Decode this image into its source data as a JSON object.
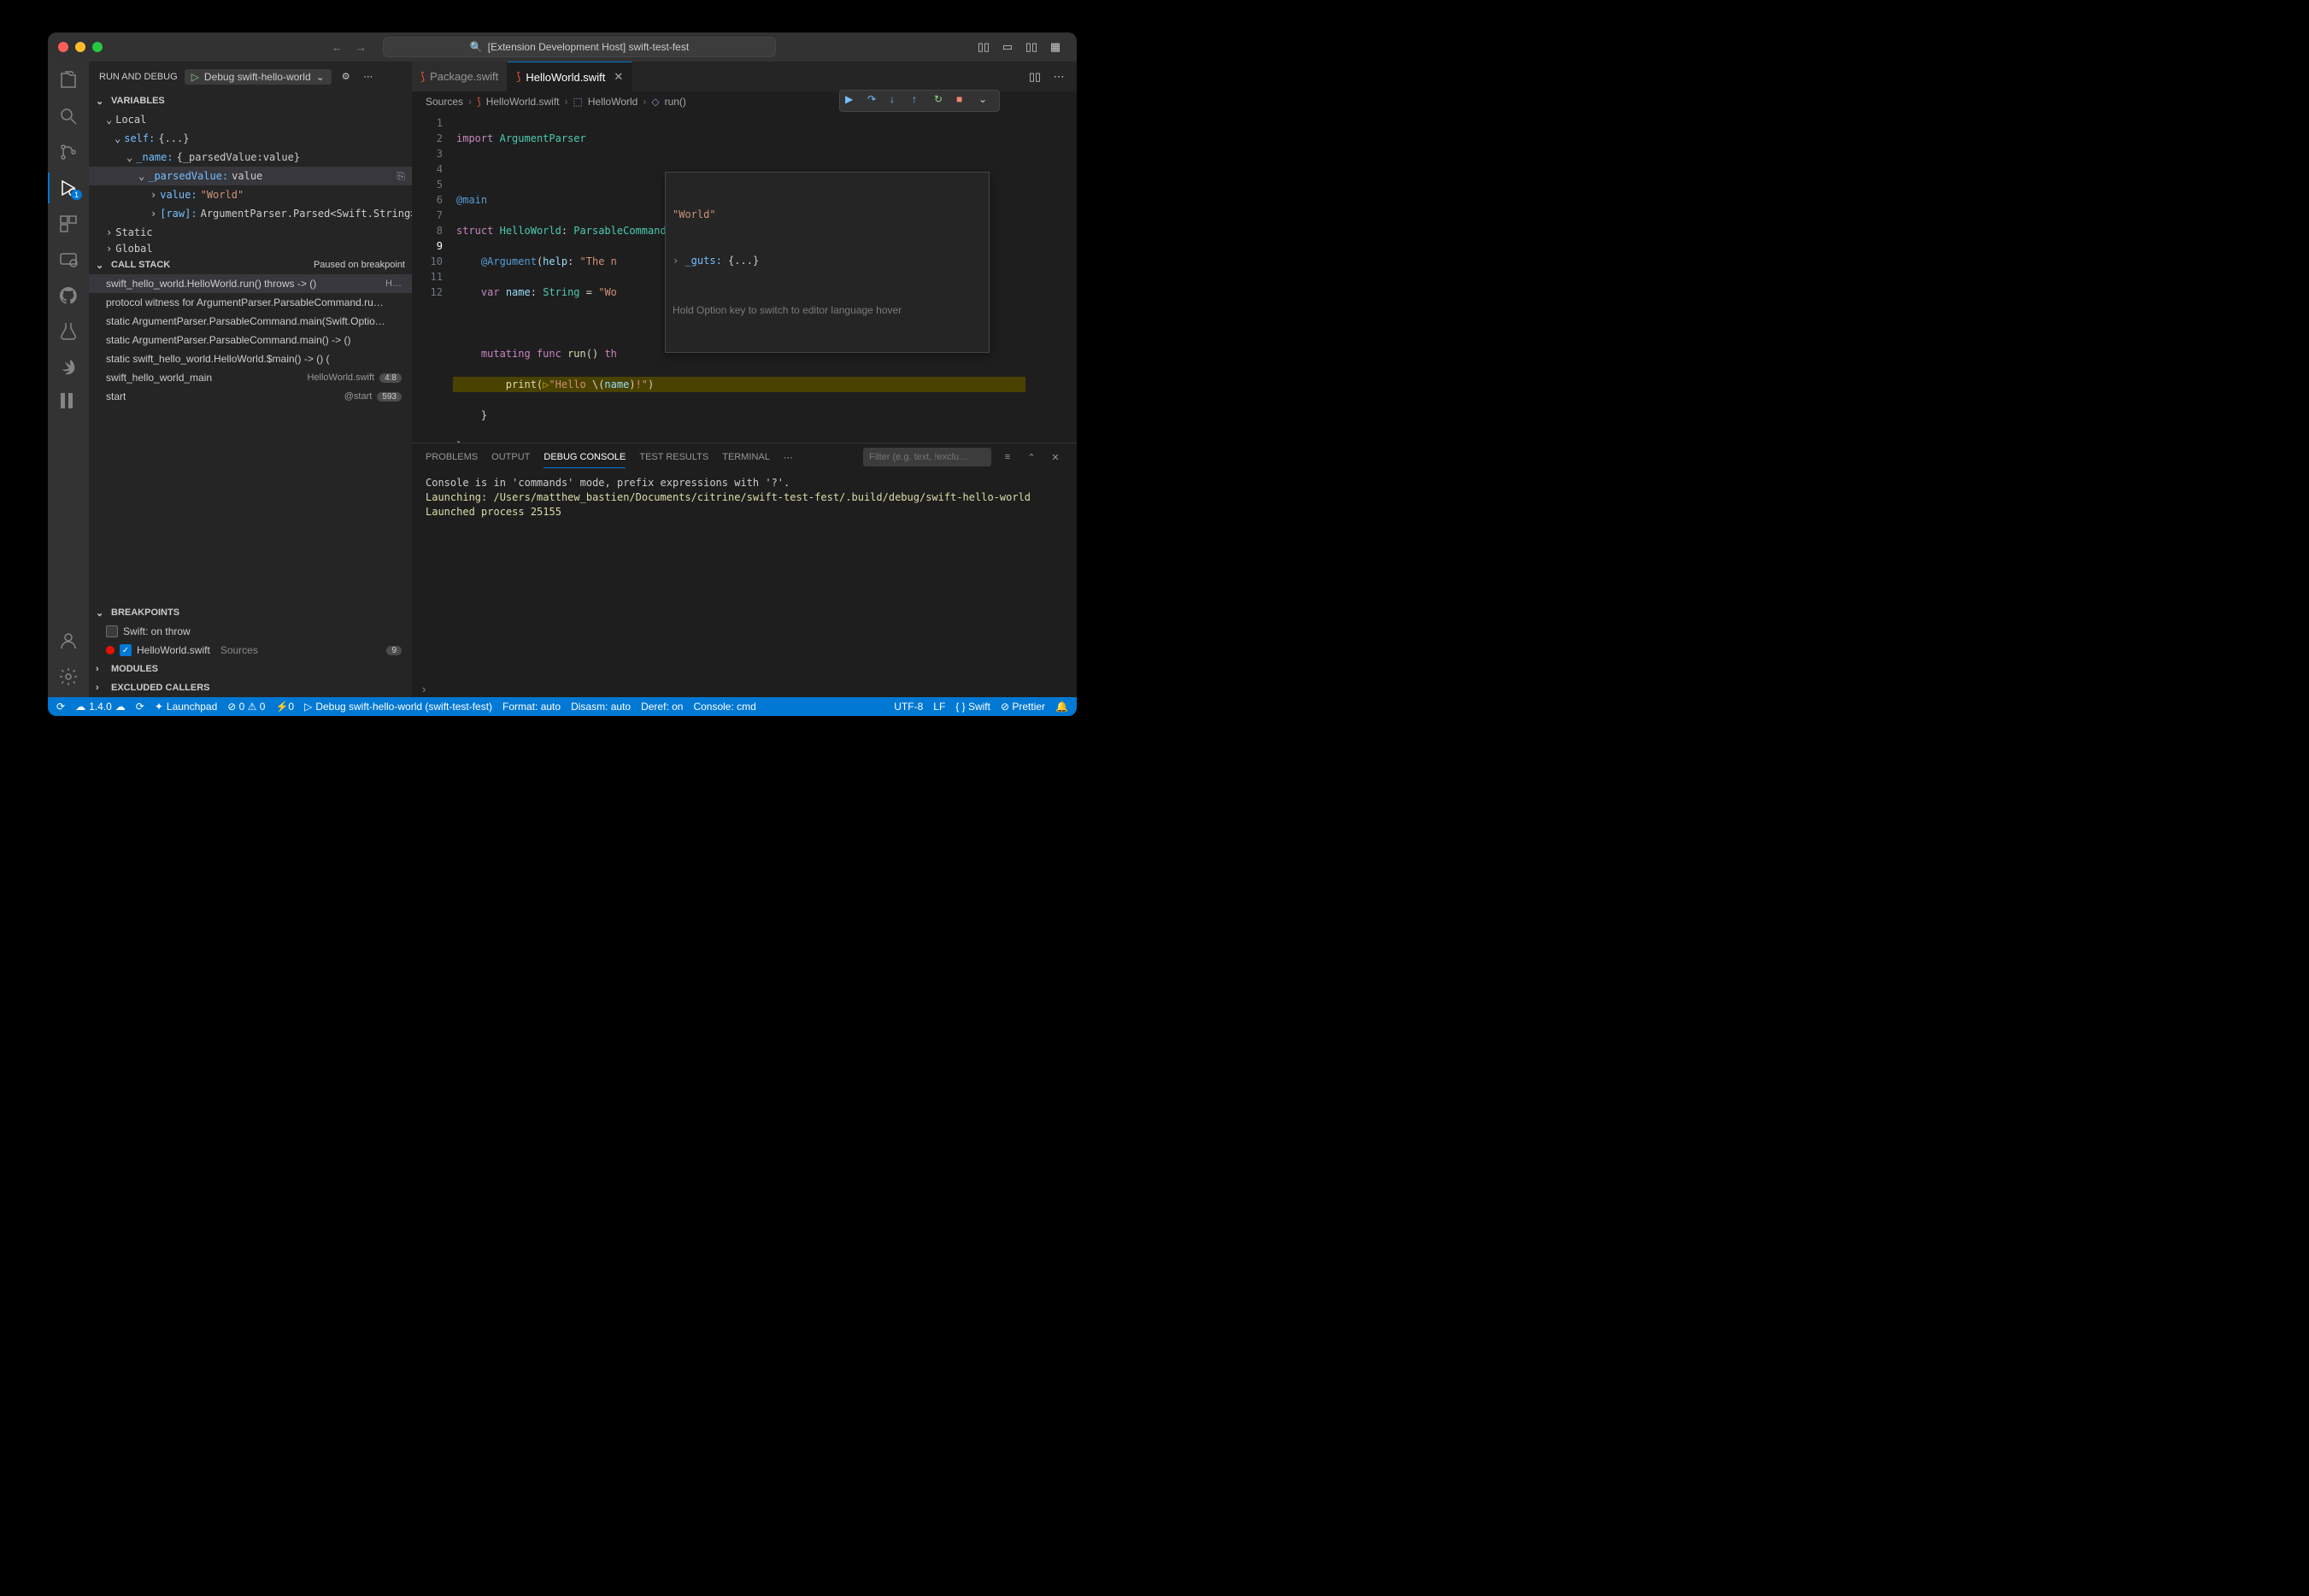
{
  "title": "[Extension Development Host] swift-test-fest",
  "sidebar_title": "Run and Debug",
  "debug_config": "Debug swift-hello-world",
  "variables": {
    "title": "Variables",
    "scopes": [
      {
        "name": "Local",
        "expanded": true
      },
      {
        "name": "Static",
        "expanded": false
      },
      {
        "name": "Global",
        "expanded": false
      }
    ],
    "tree": [
      {
        "indent": "l1",
        "key": "self:",
        "val": "{...}",
        "chev": "down"
      },
      {
        "indent": "l2",
        "key": "_name:",
        "val": "{_parsedValue:value}",
        "chev": "down"
      },
      {
        "indent": "l3",
        "key": "_parsedValue:",
        "val": "value",
        "chev": "down",
        "sel": true,
        "chip": "⎘"
      },
      {
        "indent": "l4",
        "key": "value:",
        "val": "\"World\"",
        "chev": "right"
      },
      {
        "indent": "l4",
        "key": "[raw]:",
        "val": "ArgumentParser.Parsed<Swift.String>",
        "chev": "right",
        "dimval": true
      }
    ]
  },
  "callstack": {
    "title": "Call Stack",
    "pause": "Paused on breakpoint",
    "frames": [
      {
        "text": "swift_hello_world.HelloWorld.run() throws -> ()",
        "right": "H…",
        "sel": true
      },
      {
        "text": "protocol witness for ArgumentParser.ParsableCommand.ru…"
      },
      {
        "text": "static ArgumentParser.ParsableCommand.main(Swift.Optio…"
      },
      {
        "text": "static ArgumentParser.ParsableCommand.main() -> ()"
      },
      {
        "text": "static swift_hello_world.HelloWorld.$main() -> ()  ("
      },
      {
        "text": "swift_hello_world_main",
        "file": "HelloWorld.swift",
        "badge": "4:8"
      },
      {
        "text": "start",
        "file": "@start",
        "badge": "593"
      }
    ]
  },
  "breakpoints": {
    "title": "Breakpoints",
    "items": [
      {
        "label": "Swift: on throw",
        "checked": false,
        "dot": false
      },
      {
        "label": "HelloWorld.swift",
        "secondary": "Sources",
        "checked": true,
        "dot": true,
        "count": "9"
      }
    ]
  },
  "modules_title": "Modules",
  "excluded_title": "Excluded Callers",
  "tabs": [
    {
      "label": "Package.swift"
    },
    {
      "label": "HelloWorld.swift",
      "active": true
    }
  ],
  "breadcrumb": [
    "Sources",
    "HelloWorld.swift",
    "HelloWorld",
    "run()"
  ],
  "code": {
    "lines": [
      "import ArgumentParser",
      "",
      "@main",
      "struct HelloWorld: ParsableCommand {",
      "    @Argument(help: \"The n",
      "    var name: String = \"Wo",
      "",
      "    mutating func run() th",
      "        print(⟨\"Hello \\(name)!\"⟩)",
      "    }",
      "}",
      ""
    ],
    "hl_line": 9
  },
  "hover": {
    "value": "\"World\"",
    "expand": "_guts: {...}",
    "hint": "Hold Option key to switch to editor language hover"
  },
  "panel": {
    "tabs": [
      "Problems",
      "Output",
      "Debug Console",
      "Test Results",
      "Terminal"
    ],
    "active": "Debug Console",
    "filter_placeholder": "Filter (e.g. text, !exclu…",
    "lines": [
      "Console is in 'commands' mode, prefix expressions with '?'.",
      "Launching: /Users/matthew_bastien/Documents/citrine/swift-test-fest/.build/debug/swift-hello-world",
      "Launched process 25155"
    ]
  },
  "status": {
    "left": [
      "1.4.0",
      "Launchpad",
      "⊘ 0 ⚠ 0",
      "⚡0",
      "Debug swift-hello-world (swift-test-fest)",
      "Format: auto",
      "Disasm: auto",
      "Deref: on",
      "Console: cmd"
    ],
    "right": [
      "UTF-8",
      "LF",
      "{ } Swift",
      "⊘ Prettier"
    ]
  }
}
